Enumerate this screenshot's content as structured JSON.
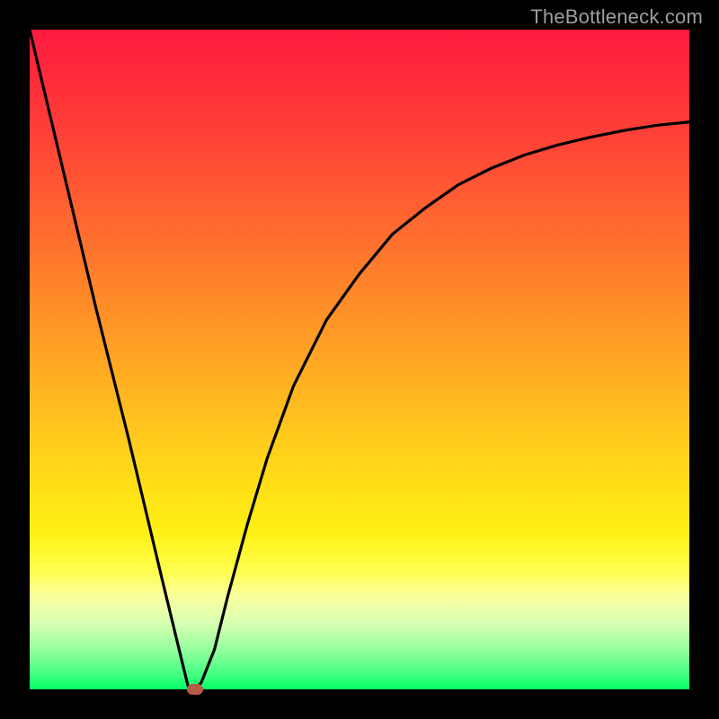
{
  "watermark": "TheBottleneck.com",
  "colors": {
    "frame": "#000000",
    "curve": "#000000",
    "marker": "#b85a4a",
    "gradient_top": "#ff1a3f",
    "gradient_bottom": "#00ff66"
  },
  "chart_data": {
    "type": "line",
    "title": "",
    "xlabel": "",
    "ylabel": "",
    "xlim": [
      0,
      100
    ],
    "ylim": [
      0,
      100
    ],
    "series": [
      {
        "name": "bottleneck-curve",
        "x": [
          0,
          5,
          10,
          15,
          20,
          24,
          25,
          26,
          28,
          30,
          33,
          36,
          40,
          45,
          50,
          55,
          60,
          65,
          70,
          75,
          80,
          85,
          90,
          95,
          100
        ],
        "y": [
          100,
          79,
          58,
          38,
          17,
          0.5,
          0,
          1,
          6,
          14,
          25,
          35,
          46,
          56,
          63,
          69,
          73,
          76.5,
          79,
          81,
          82.5,
          83.7,
          84.7,
          85.5,
          86
        ]
      }
    ],
    "marker": {
      "x": 25,
      "y": 0
    },
    "annotations": []
  }
}
